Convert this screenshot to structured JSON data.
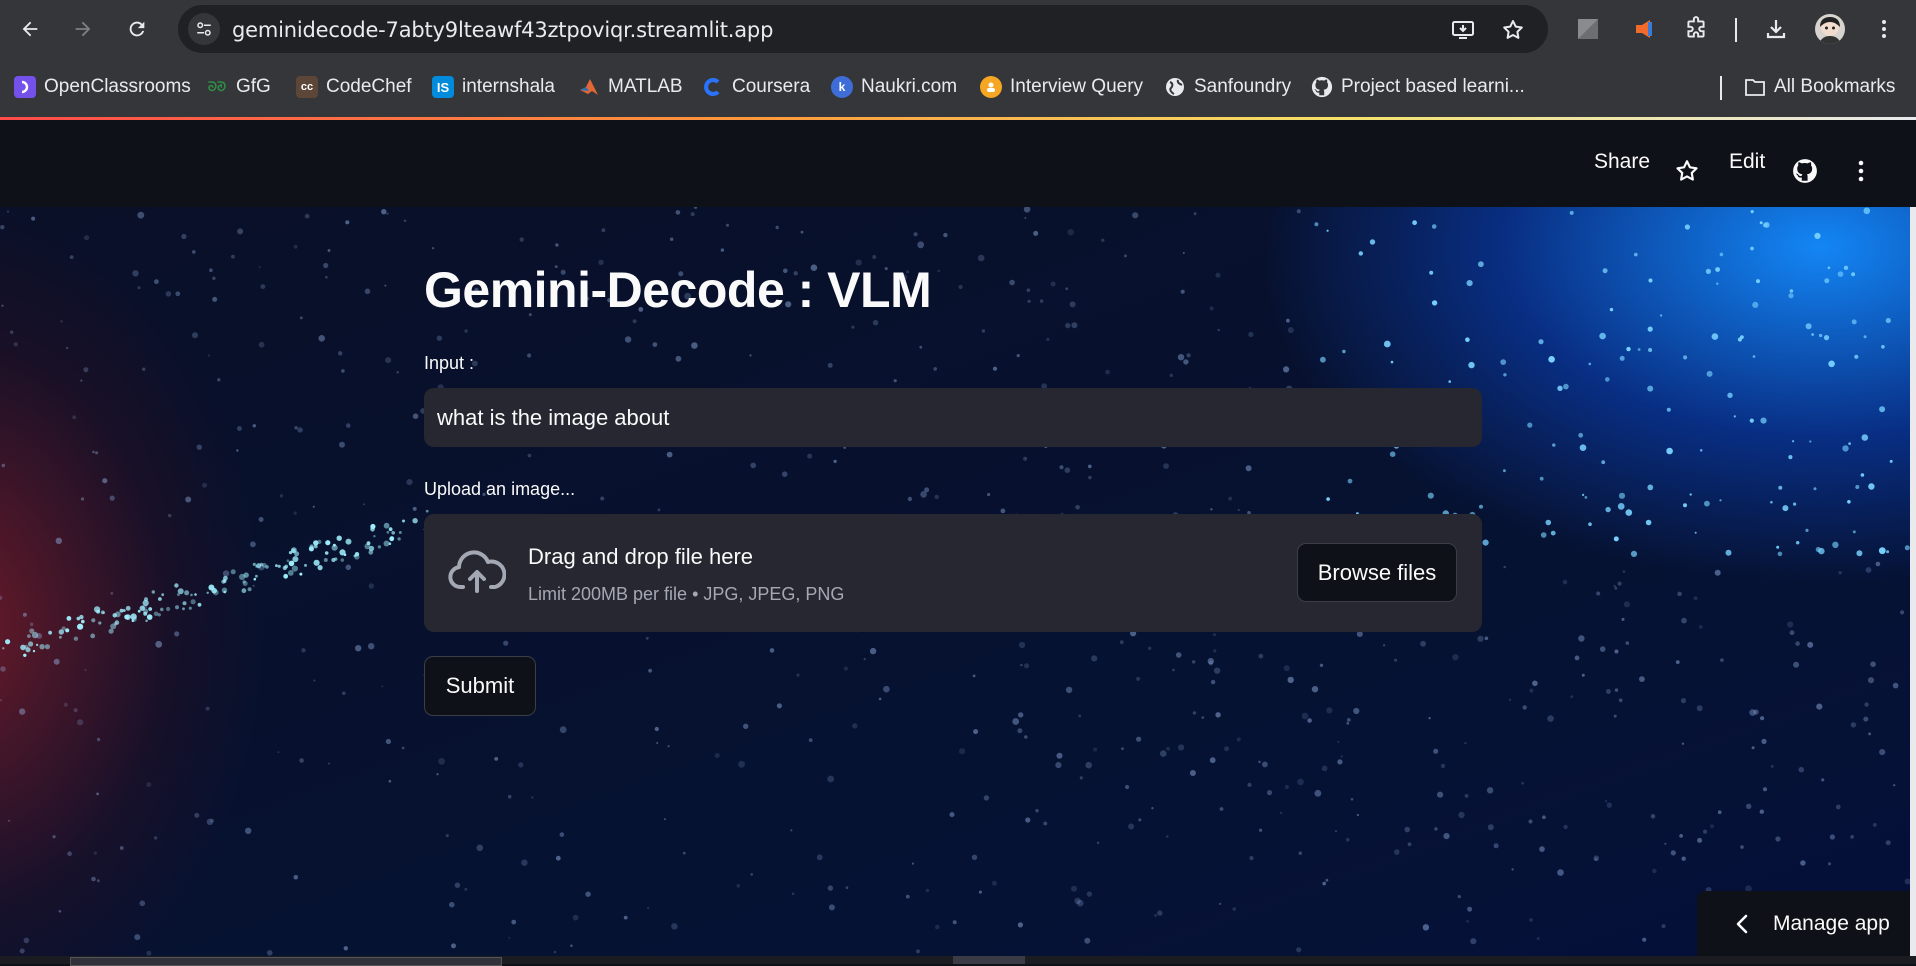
{
  "browser": {
    "url": "geminidecode-7abty9lteawf43ztpoviqr.streamlit.app",
    "bookmarks": [
      {
        "label": "OpenClassrooms",
        "icon": "openclassrooms-icon",
        "color": "#7451eb"
      },
      {
        "label": "GfG",
        "icon": "gfg-icon",
        "color": "#2f8d46"
      },
      {
        "label": "CodeChef",
        "icon": "codechef-icon",
        "color": "#5b4638"
      },
      {
        "label": "internshala",
        "icon": "internshala-icon",
        "color": "#008bdc"
      },
      {
        "label": "MATLAB",
        "icon": "matlab-icon",
        "color": "#e16737"
      },
      {
        "label": "Coursera",
        "icon": "coursera-icon",
        "color": "#0056d2"
      },
      {
        "label": "Naukri.com",
        "icon": "naukri-icon",
        "color": "#4a90e2"
      },
      {
        "label": "Interview Query",
        "icon": "interview-query-icon",
        "color": "#f5a623"
      },
      {
        "label": "Sanfoundry",
        "icon": "globe-icon",
        "color": "#e8eaed"
      },
      {
        "label": "Project based learni...",
        "icon": "github-icon",
        "color": "#e8eaed"
      }
    ],
    "all_bookmarks": "All Bookmarks"
  },
  "header": {
    "share": "Share",
    "edit": "Edit"
  },
  "app": {
    "title": "Gemini-Decode : VLM",
    "input_label": "Input :",
    "input_value": "what is the image about",
    "upload_label": "Upload an image...",
    "dropzone_title": "Drag and drop file here",
    "dropzone_subtitle": "Limit 200MB per file • JPG, JPEG, PNG",
    "browse_button": "Browse files",
    "submit_button": "Submit"
  },
  "manage_app": "Manage app",
  "colors": {
    "app_bg": "#0e1117",
    "widget_bg": "#262730",
    "text": "#fafafa",
    "muted": "#a3a8b4"
  }
}
